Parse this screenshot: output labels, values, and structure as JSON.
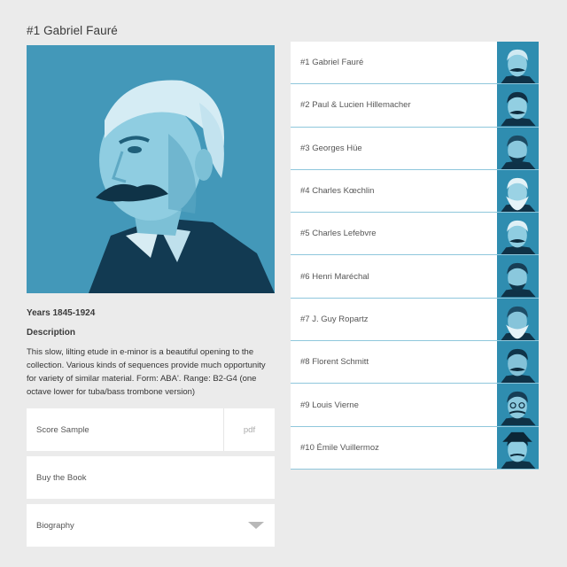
{
  "header": {
    "title": "#1 Gabriel Fauré"
  },
  "detail": {
    "years": "Years 1845-1924",
    "description_label": "Description",
    "description": "This slow, lilting etude in e-minor is a beautiful opening to the collection. Various kinds of sequences provide much opportunity for variety of similar material. Form: ABA'. Range: B2-G4 (one octave lower for tuba/bass trombone version)"
  },
  "actions": {
    "score_sample": "Score Sample",
    "pdf": "pdf",
    "buy": "Buy the Book",
    "biography": "Biography"
  },
  "composers": [
    {
      "label": "#1 Gabriel Fauré"
    },
    {
      "label": "#2 Paul & Lucien Hillemacher"
    },
    {
      "label": "#3 Georges Hüe"
    },
    {
      "label": "#4 Charles Kœchlin"
    },
    {
      "label": "#5 Charles Lefebvre"
    },
    {
      "label": "#6 Henri Maréchal"
    },
    {
      "label": "#7 J. Guy Ropartz"
    },
    {
      "label": "#8 Florent Schmitt"
    },
    {
      "label": "#9 Louis Vierne"
    },
    {
      "label": "#10 Émile Vuillermoz"
    }
  ],
  "colors": {
    "accent": "#3f97b7",
    "divider": "#8fc7dc",
    "background": "#ebebeb"
  },
  "icons": {
    "biography_toggle": "chevron-down-icon"
  }
}
